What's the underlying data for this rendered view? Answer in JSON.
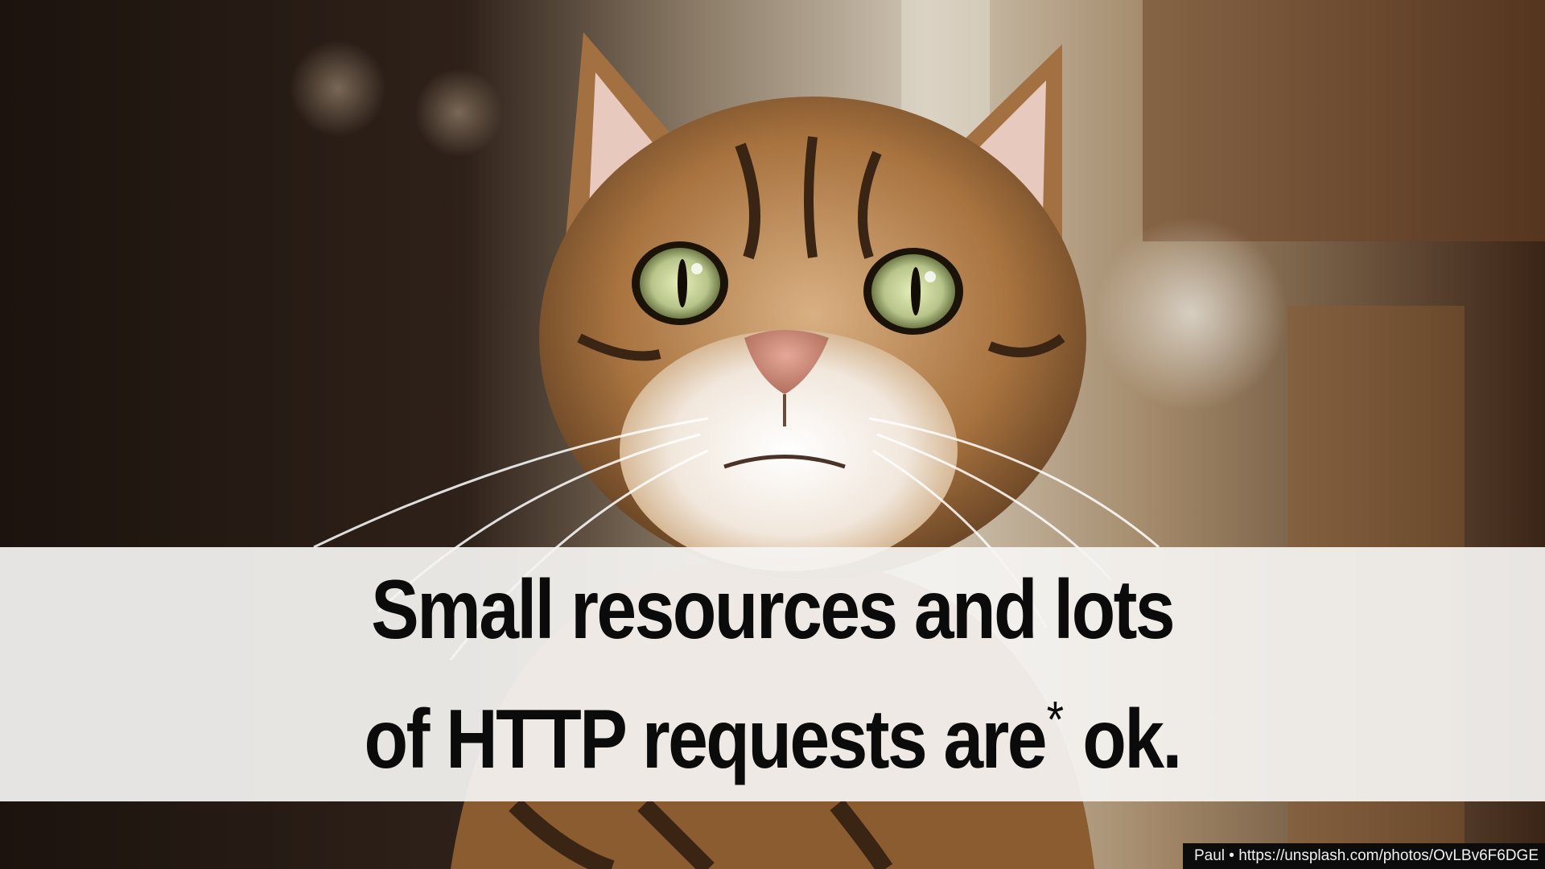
{
  "slide": {
    "headline_line1": "Small resources and lots",
    "headline_line2_prefix": "of HTTP requests are",
    "headline_asterisk": "*",
    "headline_line2_suffix": " ok.",
    "credit": "Paul • https://unsplash.com/photos/OvLBv6F6DGE"
  },
  "photo": {
    "subject": "tabby cat looking up with wide green eyes",
    "icon": "cat-photo"
  },
  "colors": {
    "banner_bg": "#f5f4f2",
    "headline_text": "#0b0b0b",
    "credit_bg": "#0c0c0c",
    "credit_text": "#f0f0f0"
  }
}
